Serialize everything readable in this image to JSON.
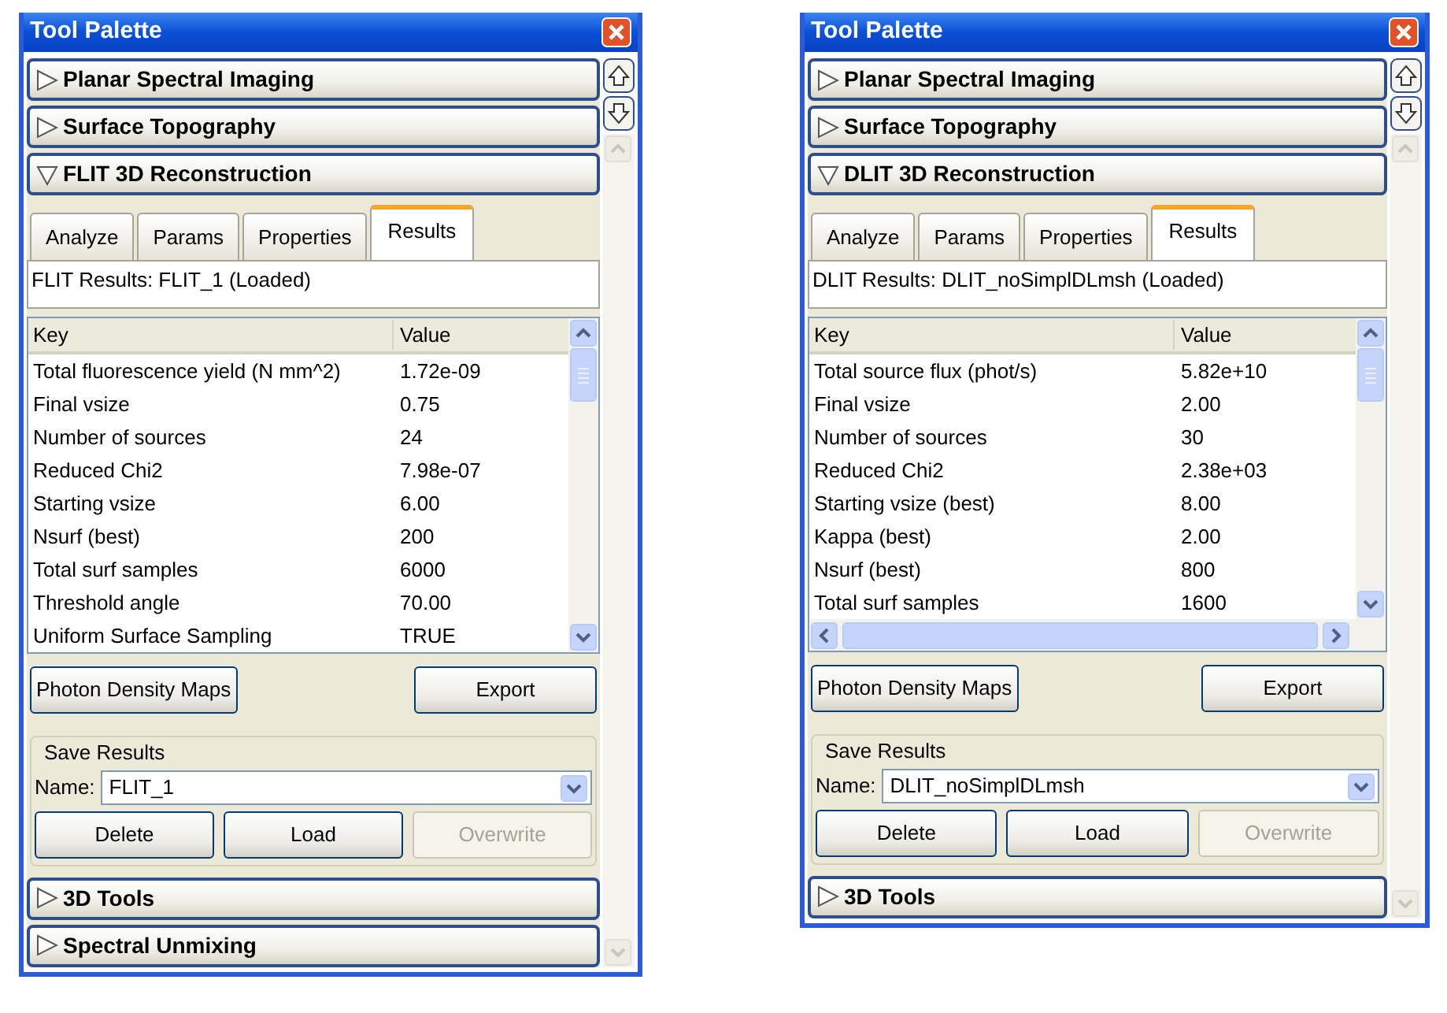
{
  "panels": [
    {
      "title": "Tool Palette",
      "sections": [
        {
          "label": "Planar Spectral Imaging",
          "expanded": false
        },
        {
          "label": "Surface Topography",
          "expanded": false
        },
        {
          "label": "FLIT 3D Reconstruction",
          "expanded": true,
          "tabs": [
            {
              "label": "Analyze",
              "selected": false
            },
            {
              "label": "Params",
              "selected": false
            },
            {
              "label": "Properties",
              "selected": false
            },
            {
              "label": "Results",
              "selected": true
            }
          ],
          "results_label": "FLIT Results: FLIT_1 (Loaded)",
          "table": {
            "columns": [
              "Key",
              "Value"
            ],
            "horizontal_scrollbar": false,
            "rows": [
              [
                "Total fluorescence yield (N mm^2)",
                "1.72e-09"
              ],
              [
                "Final vsize",
                "0.75"
              ],
              [
                "Number of sources",
                "24"
              ],
              [
                "Reduced Chi2",
                "7.98e-07"
              ],
              [
                "Starting vsize",
                "6.00"
              ],
              [
                "Nsurf (best)",
                "200"
              ],
              [
                "Total surf samples",
                "6000"
              ],
              [
                "Threshold angle",
                "70.00"
              ],
              [
                "Uniform Surface Sampling",
                "TRUE"
              ]
            ]
          },
          "buttons": [
            "Photon Density Maps",
            "Export"
          ],
          "save_group": {
            "legend": "Save Results",
            "name_label": "Name:",
            "name_value": "FLIT_1",
            "buttons": [
              {
                "label": "Delete",
                "disabled": false
              },
              {
                "label": "Load",
                "disabled": false
              },
              {
                "label": "Overwrite",
                "disabled": true
              }
            ]
          }
        },
        {
          "label": "3D Tools",
          "expanded": false
        },
        {
          "label": "Spectral Unmixing",
          "expanded": false
        }
      ]
    },
    {
      "title": "Tool Palette",
      "sections": [
        {
          "label": "Planar Spectral Imaging",
          "expanded": false
        },
        {
          "label": "Surface Topography",
          "expanded": false
        },
        {
          "label": "DLIT 3D Reconstruction",
          "expanded": true,
          "tabs": [
            {
              "label": "Analyze",
              "selected": false
            },
            {
              "label": "Params",
              "selected": false
            },
            {
              "label": "Properties",
              "selected": false
            },
            {
              "label": "Results",
              "selected": true
            }
          ],
          "results_label": "DLIT Results: DLIT_noSimplDLmsh (Loaded)",
          "table": {
            "columns": [
              "Key",
              "Value"
            ],
            "horizontal_scrollbar": true,
            "rows": [
              [
                "Total source flux (phot/s)",
                "5.82e+10"
              ],
              [
                "Final vsize",
                "2.00"
              ],
              [
                "Number of sources",
                "30"
              ],
              [
                "Reduced Chi2",
                "2.38e+03"
              ],
              [
                "Starting vsize (best)",
                "8.00"
              ],
              [
                "Kappa (best)",
                "2.00"
              ],
              [
                "Nsurf (best)",
                "800"
              ],
              [
                "Total surf samples",
                "1600"
              ]
            ]
          },
          "buttons": [
            "Photon Density Maps",
            "Export"
          ],
          "save_group": {
            "legend": "Save Results",
            "name_label": "Name:",
            "name_value": "DLIT_noSimplDLmsh",
            "buttons": [
              {
                "label": "Delete",
                "disabled": false
              },
              {
                "label": "Load",
                "disabled": false
              },
              {
                "label": "Overwrite",
                "disabled": true
              }
            ]
          }
        },
        {
          "label": "3D Tools",
          "expanded": false
        }
      ]
    }
  ]
}
